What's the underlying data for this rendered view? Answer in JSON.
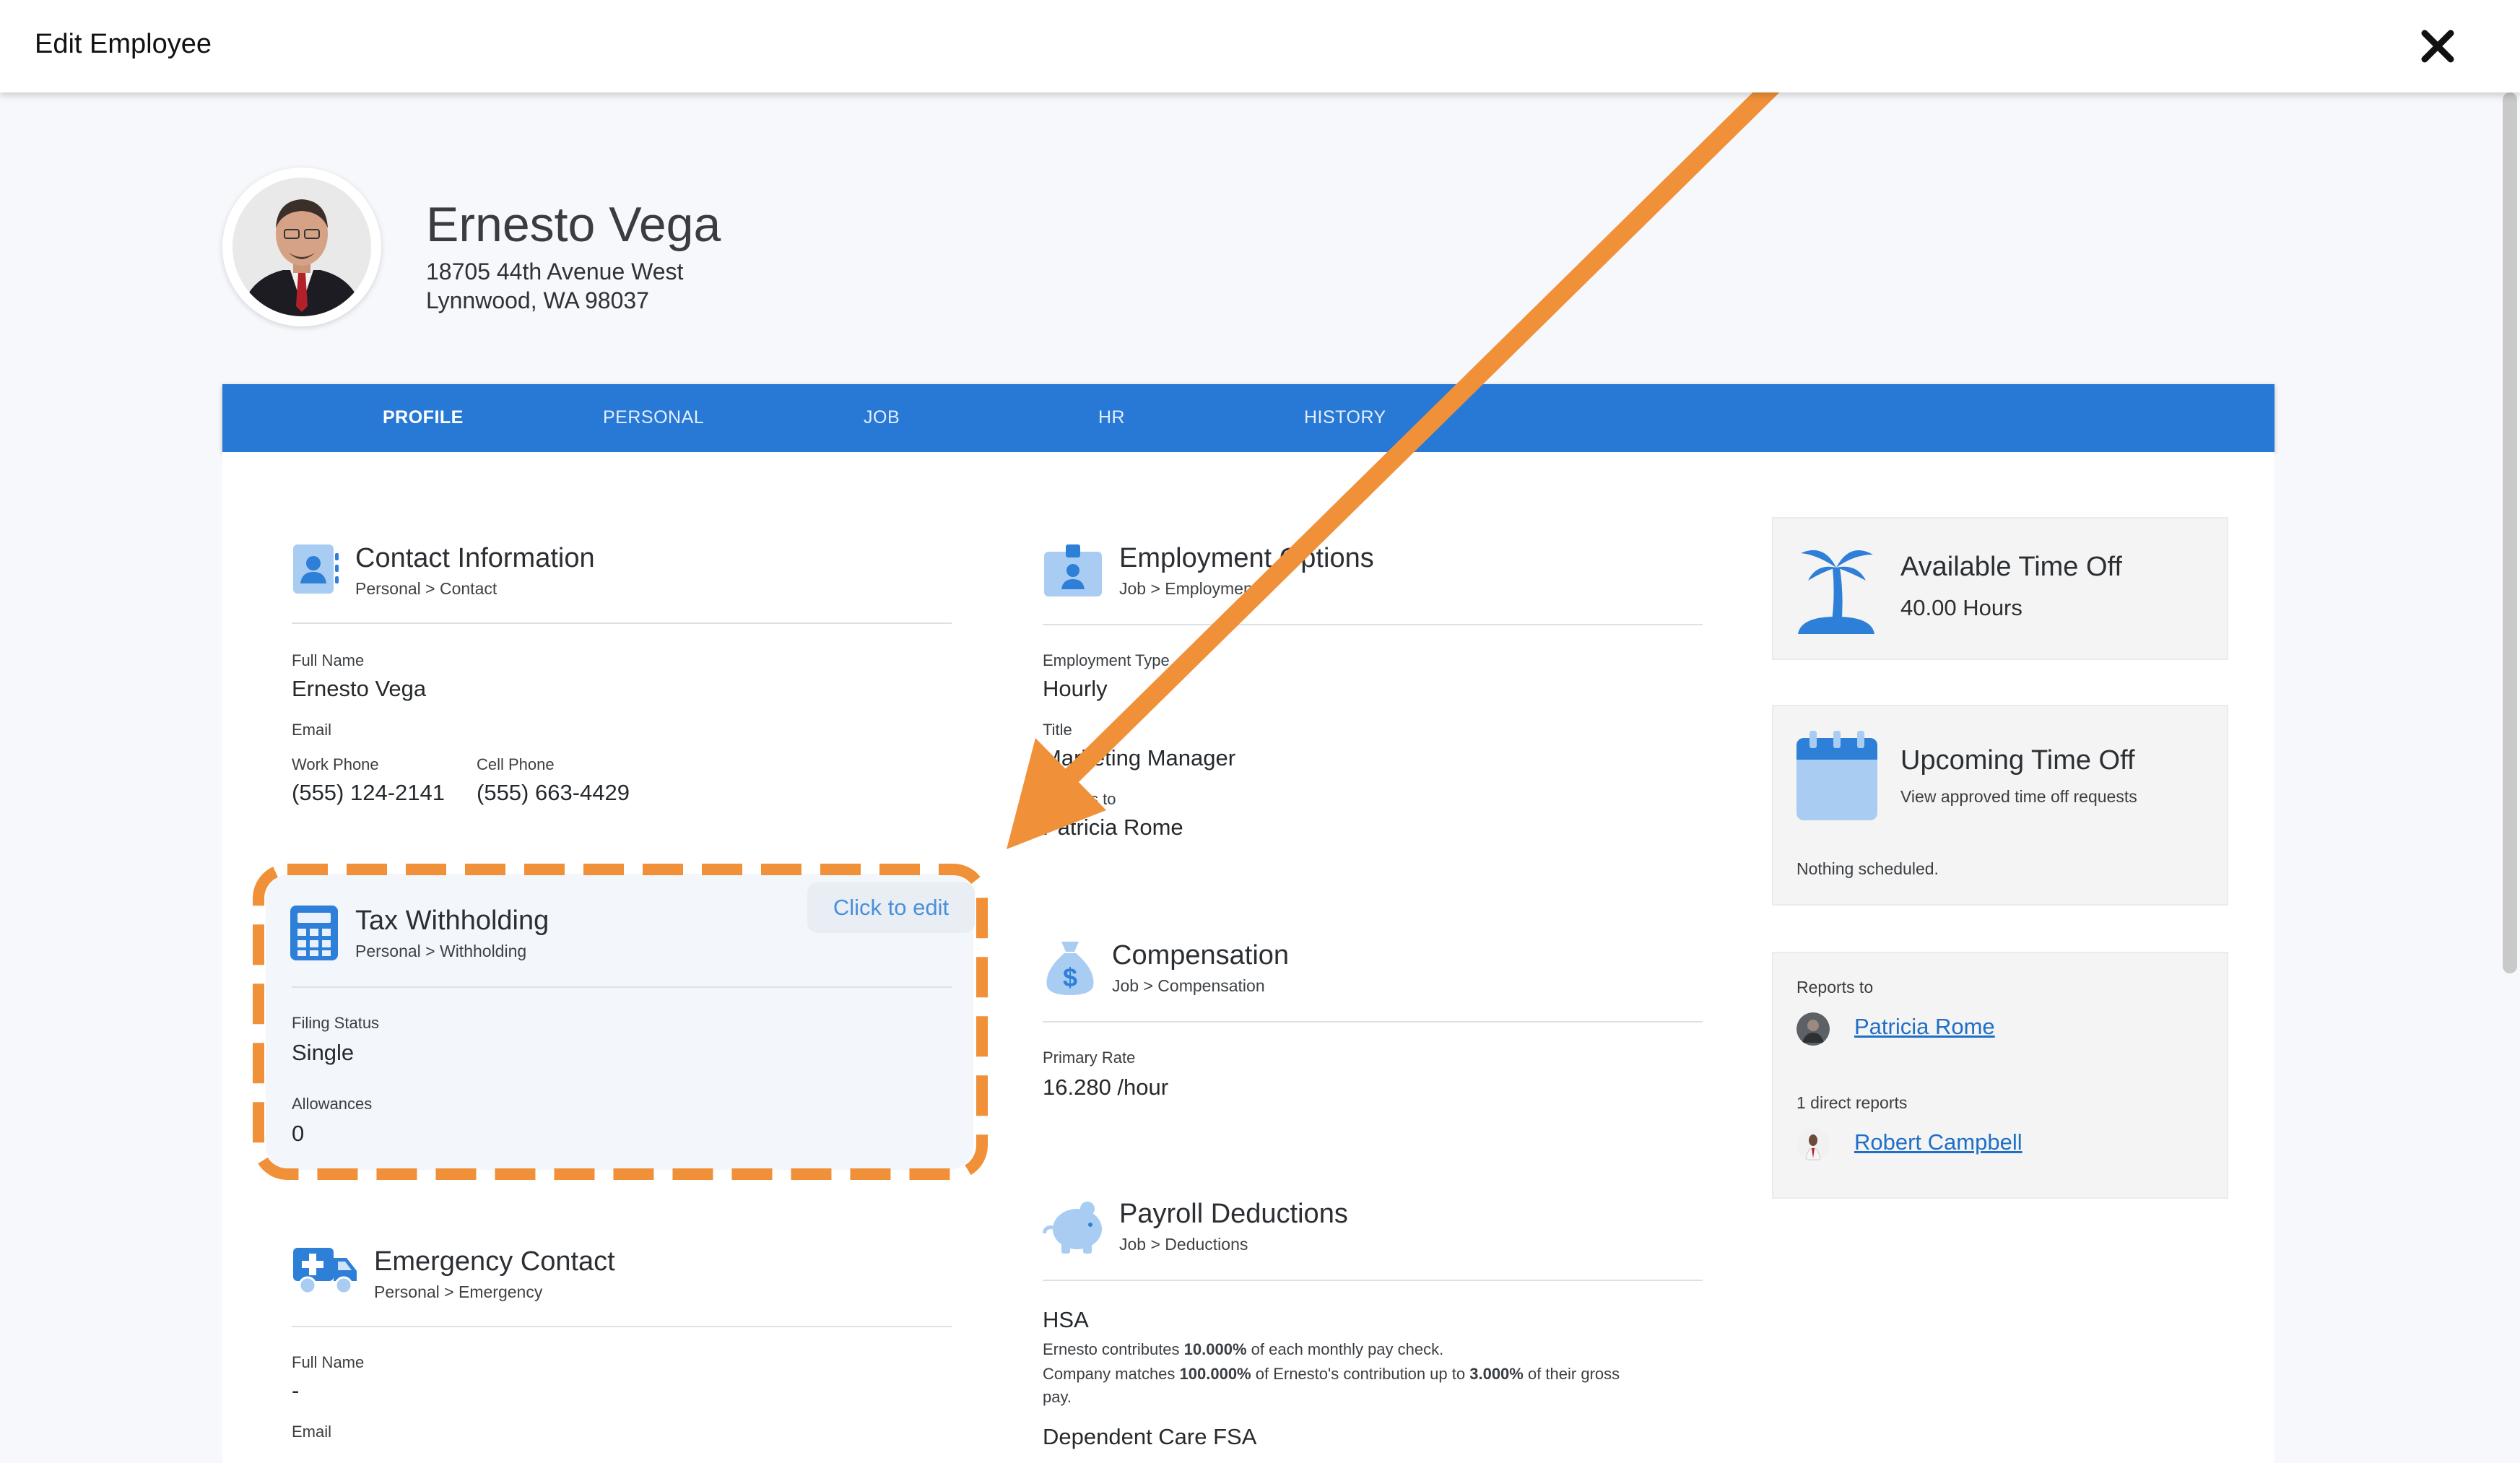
{
  "window": {
    "title": "Edit Employee"
  },
  "employee": {
    "name": "Ernesto Vega",
    "address_line1": "18705 44th Avenue West",
    "address_line2": "Lynnwood, WA 98037"
  },
  "tabs": [
    {
      "label": "PROFILE",
      "active": true
    },
    {
      "label": "PERSONAL",
      "active": false
    },
    {
      "label": "JOB",
      "active": false
    },
    {
      "label": "HR",
      "active": false
    },
    {
      "label": "HISTORY",
      "active": false
    }
  ],
  "contact": {
    "title": "Contact Information",
    "breadcrumb": "Personal > Contact",
    "full_name_label": "Full Name",
    "full_name": "Ernesto Vega",
    "email_label": "Email",
    "work_phone_label": "Work Phone",
    "work_phone": "(555) 124-2141",
    "cell_phone_label": "Cell Phone",
    "cell_phone": "(555) 663-4429"
  },
  "tax": {
    "title": "Tax Withholding",
    "breadcrumb": "Personal > Withholding",
    "click_to_edit": "Click to edit",
    "filing_status_label": "Filing Status",
    "filing_status": "Single",
    "allowances_label": "Allowances",
    "allowances": "0"
  },
  "emergency": {
    "title": "Emergency Contact",
    "breadcrumb": "Personal > Emergency",
    "full_name_label": "Full Name",
    "full_name": "-",
    "email_label": "Email"
  },
  "employment": {
    "title": "Employment Options",
    "breadcrumb": "Job > Employment",
    "type_label": "Employment Type",
    "type": "Hourly",
    "title_label": "Title",
    "job_title": "Marketing Manager",
    "reports_to_label": "Reports to",
    "reports_to": "Patricia Rome"
  },
  "compensation": {
    "title": "Compensation",
    "breadcrumb": "Job > Compensation",
    "primary_rate_label": "Primary Rate",
    "primary_rate": "16.280 /hour"
  },
  "deductions": {
    "title": "Payroll Deductions",
    "breadcrumb": "Job > Deductions",
    "hsa_title": "HSA",
    "hsa_line1_pre": "Ernesto contributes ",
    "hsa_line1_bold": "10.000%",
    "hsa_line1_post": " of each monthly pay check.",
    "hsa_line2_pre": "Company matches ",
    "hsa_line2_bold1": "100.000%",
    "hsa_line2_mid": " of Ernesto's contribution up to ",
    "hsa_line2_bold2": "3.000%",
    "hsa_line2_post": " of their gross",
    "hsa_line3": "pay.",
    "dependent_care_title": "Dependent Care FSA"
  },
  "time_off": {
    "title": "Available Time Off",
    "hours": "40.00 Hours"
  },
  "upcoming": {
    "title": "Upcoming Time Off",
    "subtitle": "View approved time off requests",
    "empty": "Nothing scheduled."
  },
  "org": {
    "reports_to_label": "Reports to",
    "manager": "Patricia Rome",
    "direct_reports_label": "1 direct reports",
    "direct_report": "Robert Campbell"
  },
  "colors": {
    "tab_bar": "#2879d5",
    "accent_icon": "#2d7fd8",
    "annotation": "#f0913a",
    "link": "#1f6fc6"
  }
}
